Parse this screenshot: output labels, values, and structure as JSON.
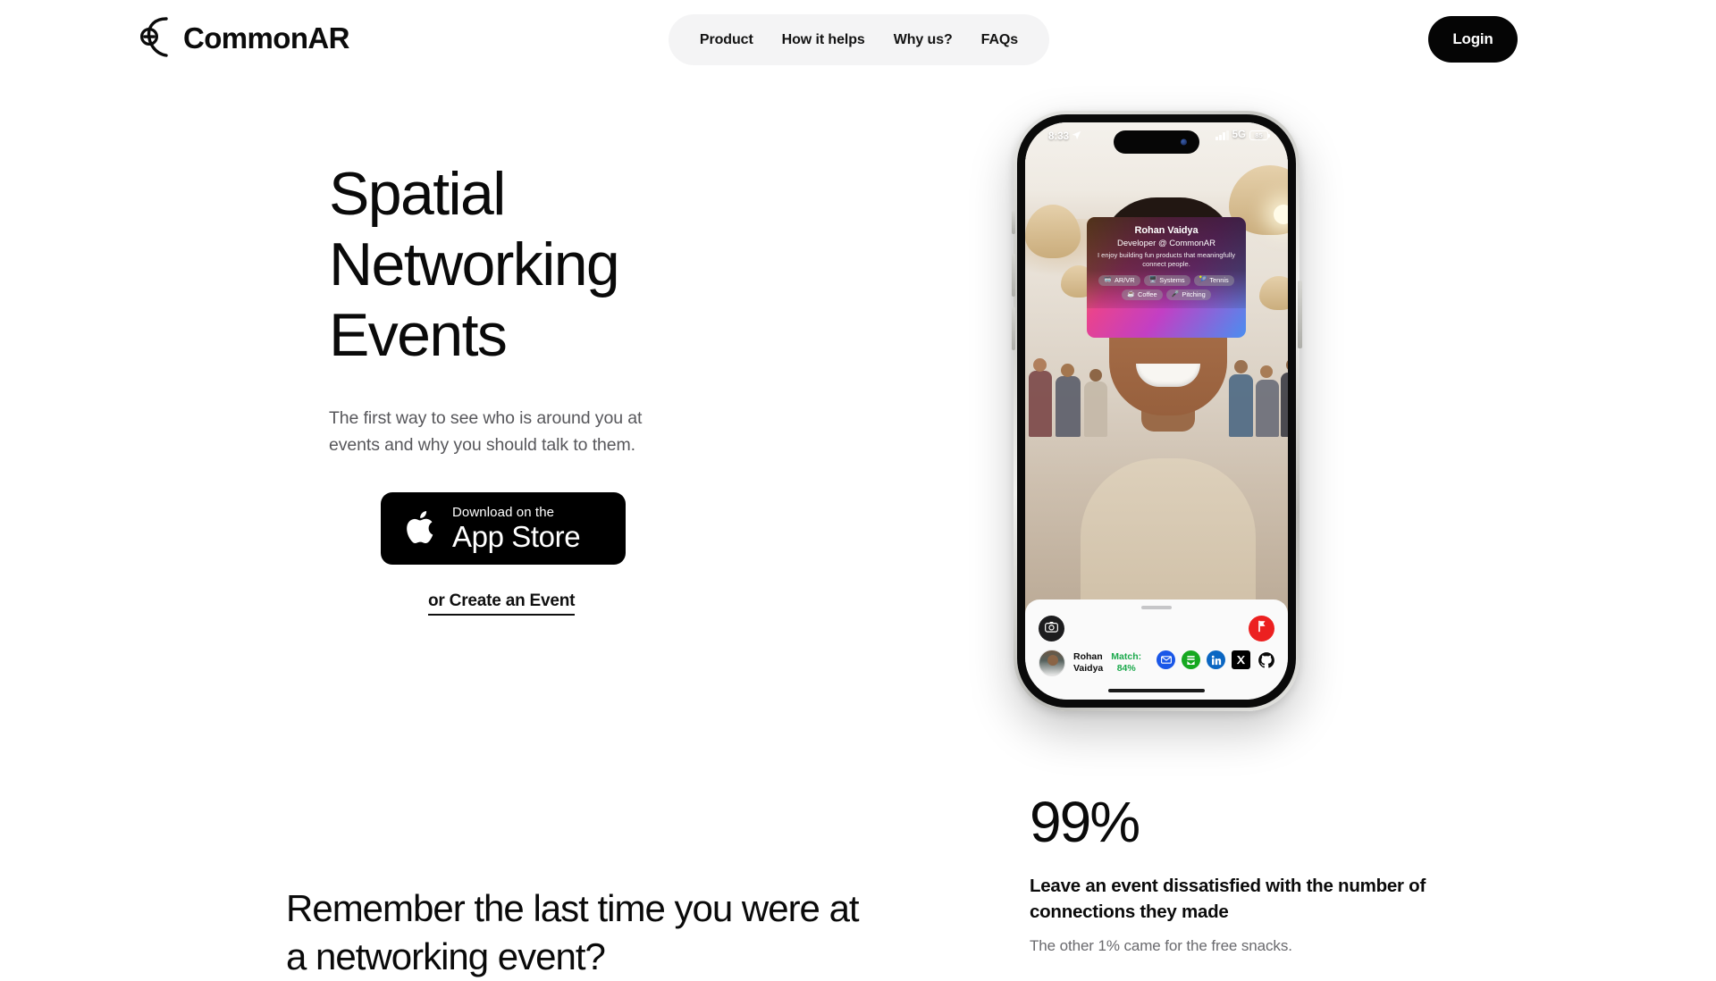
{
  "header": {
    "brand_name": "CommonAR",
    "logo_icon": "commonar-c-lens-logo",
    "nav_items": [
      {
        "label": "Product"
      },
      {
        "label": "How it helps"
      },
      {
        "label": "Why us?"
      },
      {
        "label": "FAQs"
      }
    ],
    "login_label": "Login"
  },
  "hero": {
    "title": "Spatial\nNetworking\nEvents",
    "subtitle": "The first way to see who is around you at events and why you should talk to them.",
    "appstore": {
      "icon": "apple-logo-icon",
      "small_label": "Download on the",
      "big_label": "App Store"
    },
    "create_event_label": "or Create an Event"
  },
  "phone": {
    "status_bar": {
      "time": "8:33",
      "location_icon": "location-arrow-icon",
      "signal_icon": "cellular-bars-icon",
      "network": "5G",
      "battery_level": "85"
    },
    "ar_card": {
      "name": "Rohan Vaidya",
      "role": "Developer @ CommonAR",
      "bio": "I enjoy building fun products that meaningfully connect people.",
      "tags": [
        {
          "emoji": "🥽",
          "label": "AR/VR"
        },
        {
          "emoji": "🖥️",
          "label": "Systems"
        },
        {
          "emoji": "🎾",
          "label": "Tennis"
        },
        {
          "emoji": "☕",
          "label": "Coffee"
        },
        {
          "emoji": "🎤",
          "label": "Pitching"
        }
      ]
    },
    "sheet": {
      "camera_icon": "camera-icon",
      "flag_icon": "report-flag-icon",
      "avatar_icon": "user-avatar",
      "person_name_line1": "Rohan",
      "person_name_line2": "Vaidya",
      "match_label": "Match:",
      "match_value": "84%",
      "socials": [
        {
          "name": "email-icon",
          "glyph": "✉"
        },
        {
          "name": "substack-icon",
          "glyph": "🗒"
        },
        {
          "name": "linkedin-icon",
          "glyph": "in"
        },
        {
          "name": "x-twitter-icon",
          "glyph": "𝕏"
        },
        {
          "name": "github-icon",
          "glyph": ""
        }
      ]
    }
  },
  "stats": {
    "number": "99%",
    "headline": "Leave an event dissatisfied with the number of connections they made",
    "note": "The other 1% came for the free snacks."
  },
  "section": {
    "heading": "Remember the last time you were at\na networking event?"
  },
  "colors": {
    "accent_black": "#050505",
    "nav_pill_bg": "#f4f4f5",
    "match_green": "#1ba94c",
    "report_red": "#ec2020",
    "muted_text": "#57575b"
  }
}
